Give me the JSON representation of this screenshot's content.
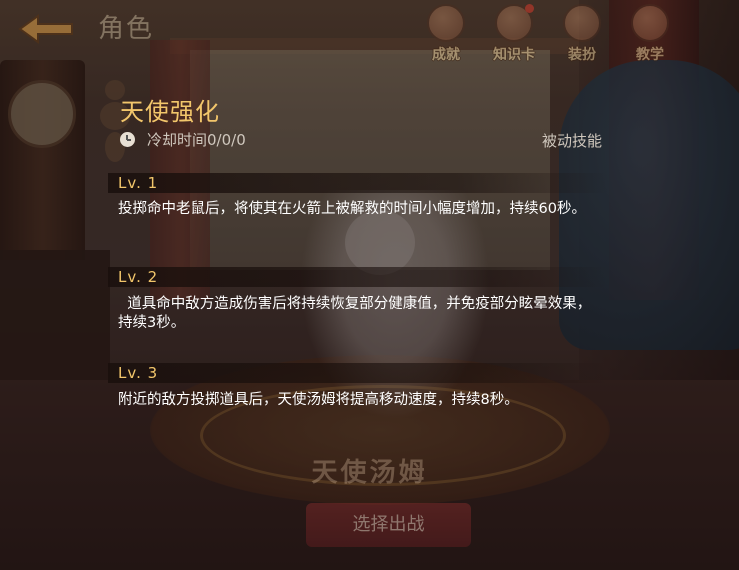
{
  "topbar": {
    "title": "角色",
    "buttons": [
      {
        "label": "成就",
        "icon": "trophy-icon"
      },
      {
        "label": "知识卡",
        "icon": "card-icon",
        "badge": true
      },
      {
        "label": "装扮",
        "icon": "outfit-icon"
      },
      {
        "label": "教学",
        "icon": "book-icon"
      }
    ]
  },
  "skill": {
    "name": "天使强化",
    "cooldown": "冷却时间0/0/0",
    "type": "被动技能",
    "levels": [
      {
        "label": "Lv. 1",
        "desc": "投掷命中老鼠后，将使其在火箭上被解救的时间小幅度增加，持续60秒。"
      },
      {
        "label": "Lv. 2",
        "desc": "  道具命中敌方造成伤害后将持续恢复部分健康值，并免疫部分眩晕效果，持续3秒。"
      },
      {
        "label": "Lv. 3",
        "desc": "附近的敌方投掷道具后，天使汤姆将提高移动速度，持续8秒。"
      }
    ]
  },
  "character": {
    "name": "天使汤姆",
    "select_label": "选择出战"
  },
  "colors": {
    "accent_gold": "#f2c66b",
    "desc_text": "#ffffff",
    "sub_text": "#cfc7bd"
  }
}
